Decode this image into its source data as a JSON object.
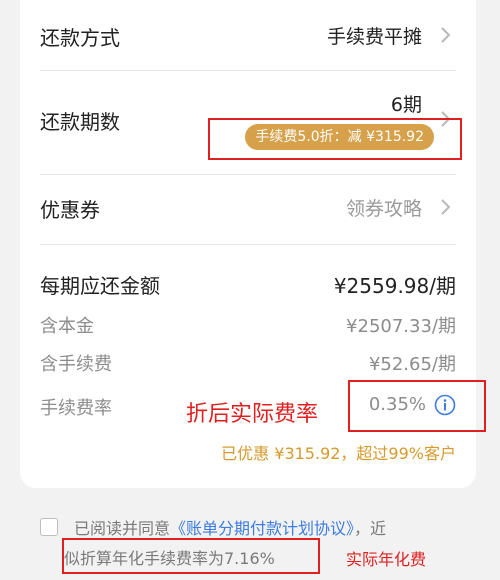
{
  "repayment_method": {
    "label": "还款方式",
    "value": "手续费平摊"
  },
  "repayment_periods": {
    "label": "还款期数",
    "value": "6期",
    "discount_badge": "手续费5.0折：减 ¥315.92"
  },
  "coupon": {
    "label": "优惠券",
    "value": "领券攻略"
  },
  "per_period": {
    "label": "每期应还金额",
    "value": "¥2559.98/期"
  },
  "principal": {
    "label": "含本金",
    "value": "¥2507.33/期"
  },
  "fee": {
    "label": "含手续费",
    "value": "¥52.65/期"
  },
  "fee_rate": {
    "label": "手续费率",
    "value": "0.35%"
  },
  "annotation_actual_rate": "折后实际费率",
  "promo_text": "已优惠 ¥315.92，超过99%客户",
  "agreement": {
    "prefix": "已阅读并同意",
    "link": "《账单分期付款计划协议》",
    "suffix_line1": "，近",
    "line2": "似折算年化手续费率为7.16%"
  },
  "annotation_actual_annual": "实际年化费",
  "colors": {
    "accent_gold": "#d6a14a",
    "annotation_red": "#e02020",
    "link_blue": "#3d7de0"
  }
}
